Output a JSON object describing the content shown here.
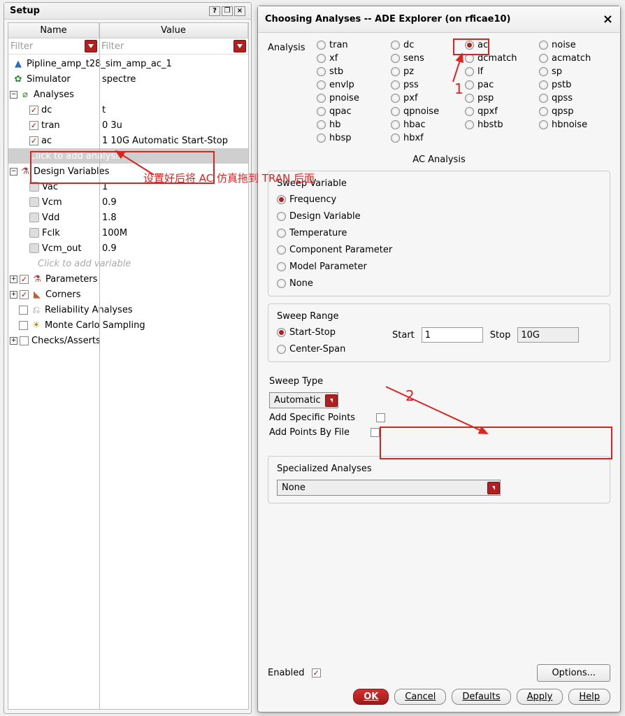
{
  "setup": {
    "title": "Setup",
    "columns": {
      "name": "Name",
      "value": "Value"
    },
    "filter": "Filter",
    "tree": {
      "pipeline": "Pipline_amp_t28_sim_amp_ac_1",
      "simulator": {
        "label": "Simulator",
        "value": "spectre"
      },
      "analyses": {
        "label": "Analyses",
        "items": [
          {
            "name": "dc",
            "value": "t",
            "checked": true
          },
          {
            "name": "tran",
            "value": "0 3u",
            "checked": true
          },
          {
            "name": "ac",
            "value": "1 10G Automatic Start-Stop",
            "checked": true
          }
        ],
        "add": "Click to add analysis"
      },
      "designVars": {
        "label": "Design Variables",
        "items": [
          {
            "name": "Vac",
            "value": "1"
          },
          {
            "name": "Vcm",
            "value": "0.9"
          },
          {
            "name": "Vdd",
            "value": "1.8"
          },
          {
            "name": "Fclk",
            "value": "100M"
          },
          {
            "name": "Vcm_out",
            "value": "0.9"
          }
        ],
        "add": "Click to add variable"
      },
      "parameters": "Parameters",
      "corners": "Corners",
      "reliability": "Reliability Analyses",
      "monteCarlo": "Monte Carlo Sampling",
      "checks": "Checks/Asserts"
    }
  },
  "dialog": {
    "title": "Choosing Analyses -- ADE Explorer (on rficae10)",
    "analysisLabel": "Analysis",
    "analyses": [
      "tran",
      "dc",
      "ac",
      "noise",
      "xf",
      "sens",
      "dcmatch",
      "acmatch",
      "stb",
      "pz",
      "lf",
      "sp",
      "envlp",
      "pss",
      "pac",
      "pstb",
      "pnoise",
      "pxf",
      "psp",
      "qpss",
      "qpac",
      "qpnoise",
      "qpxf",
      "qpsp",
      "hb",
      "hbac",
      "hbstb",
      "hbnoise",
      "hbsp",
      "hbxf"
    ],
    "selectedAnalysis": "ac",
    "sectionTitle": "AC Analysis",
    "sweepVar": {
      "title": "Sweep Variable",
      "options": [
        "Frequency",
        "Design Variable",
        "Temperature",
        "Component Parameter",
        "Model Parameter",
        "None"
      ],
      "selected": "Frequency"
    },
    "sweepRange": {
      "title": "Sweep Range",
      "startStop": "Start-Stop",
      "centerSpan": "Center-Span",
      "selected": "Start-Stop",
      "startLabel": "Start",
      "stopLabel": "Stop",
      "start": "1",
      "stop": "10G"
    },
    "sweepType": {
      "title": "Sweep Type",
      "value": "Automatic"
    },
    "addSpecific": "Add Specific Points",
    "addByFile": "Add Points By File",
    "specialized": {
      "title": "Specialized Analyses",
      "value": "None"
    },
    "enabled": "Enabled",
    "options": "Options...",
    "buttons": {
      "ok": "OK",
      "cancel": "Cancel",
      "defaults": "Defaults",
      "apply": "Apply",
      "help": "Help"
    }
  },
  "annotations": {
    "text": "设置好后将 AC 仿真拖到 TRAN 后面",
    "num1": "1",
    "num2": "2"
  }
}
